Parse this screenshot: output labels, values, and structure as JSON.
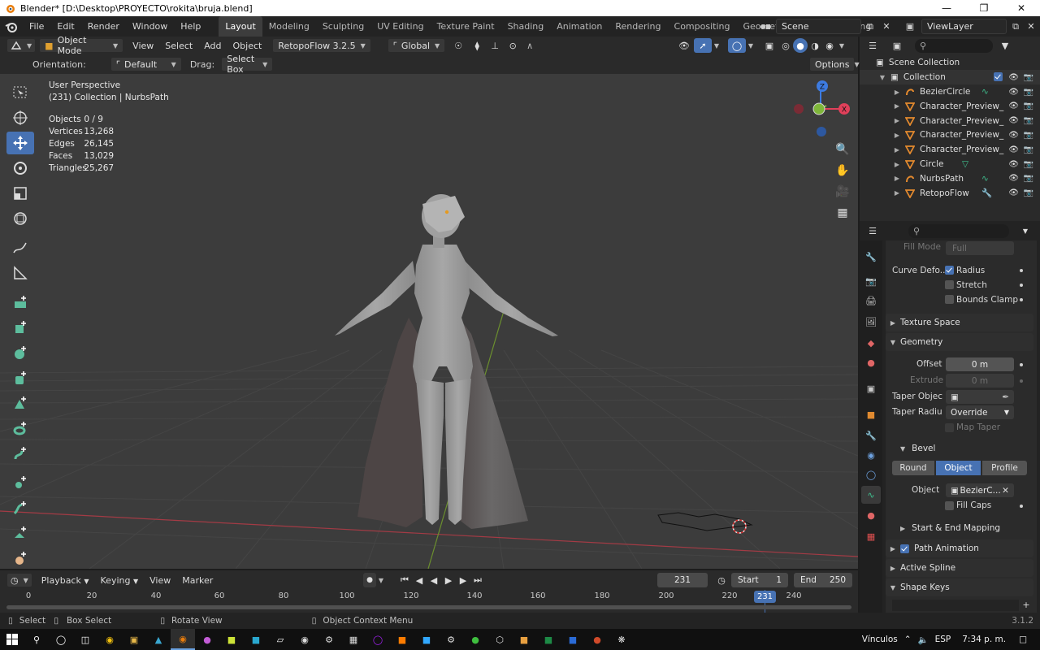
{
  "window": {
    "title": "Blender* [D:\\Desktop\\PROYECTO\\rokita\\bruja.blend]"
  },
  "menu": [
    "File",
    "Edit",
    "Render",
    "Window",
    "Help"
  ],
  "workspaces": [
    "Layout",
    "Modeling",
    "Sculpting",
    "UV Editing",
    "Texture Paint",
    "Shading",
    "Animation",
    "Rendering",
    "Compositing",
    "Geometry Nodes",
    "Scripting"
  ],
  "active_workspace": "Layout",
  "scene": "Scene",
  "view_layer": "ViewLayer",
  "viewport_header": {
    "mode": "Object Mode",
    "menus": [
      "View",
      "Select",
      "Add",
      "Object"
    ],
    "addon": "RetopoFlow 3.2.5",
    "transform_orientation": "Global"
  },
  "tool_settings": {
    "orientation_label": "Orientation:",
    "orientation_value": "Default",
    "drag_label": "Drag:",
    "drag_value": "Select Box",
    "options_label": "Options"
  },
  "overlay": {
    "view_name": "User Perspective",
    "context": "(231) Collection | NurbsPath",
    "stats": [
      {
        "label": "Objects",
        "value": "0 / 9"
      },
      {
        "label": "Vertices",
        "value": "13,268"
      },
      {
        "label": "Edges",
        "value": "26,145"
      },
      {
        "label": "Faces",
        "value": "13,029"
      },
      {
        "label": "Triangles",
        "value": "25,267"
      }
    ]
  },
  "gizmo": {
    "z": "Z",
    "x": "X"
  },
  "outliner": {
    "scene_collection": "Scene Collection",
    "collection": "Collection",
    "items": [
      {
        "name": "BezierCircle",
        "type": "curve"
      },
      {
        "name": "Character_Preview_",
        "type": "mesh"
      },
      {
        "name": "Character_Preview_",
        "type": "mesh"
      },
      {
        "name": "Character_Preview_",
        "type": "mesh"
      },
      {
        "name": "Character_Preview_",
        "type": "mesh"
      },
      {
        "name": "Circle",
        "type": "mesh"
      },
      {
        "name": "NurbsPath",
        "type": "curve"
      },
      {
        "name": "RetopoFlow",
        "type": "mesh"
      }
    ]
  },
  "properties": {
    "fill_mode_label": "Fill Mode",
    "fill_mode_value": "Full",
    "curve_deform_label": "Curve Defo...",
    "radius": {
      "label": "Radius",
      "checked": true
    },
    "stretch": {
      "label": "Stretch",
      "checked": false
    },
    "bounds_clamp": {
      "label": "Bounds Clamp",
      "checked": false
    },
    "texture_space": "Texture Space",
    "geometry": "Geometry",
    "offset_label": "Offset",
    "offset_value": "0 m",
    "extrude_label": "Extrude",
    "extrude_value": "0 m",
    "taper_object_label": "Taper Objec",
    "taper_radius_label": "Taper Radiu",
    "taper_radius_value": "Override",
    "map_taper": "Map Taper",
    "bevel": "Bevel",
    "bevel_modes": [
      "Round",
      "Object",
      "Profile"
    ],
    "bevel_active": "Object",
    "bevel_object_label": "Object",
    "bevel_object_value": "BezierC...",
    "fill_caps": "Fill Caps",
    "start_end_mapping": "Start & End Mapping",
    "path_animation": "Path Animation",
    "active_spline": "Active Spline",
    "shape_keys": "Shape Keys"
  },
  "timeline": {
    "menus": [
      "Playback",
      "Keying",
      "View",
      "Marker"
    ],
    "current_frame": "231",
    "start_label": "Start",
    "start_value": "1",
    "end_label": "End",
    "end_value": "250",
    "ticks": [
      "0",
      "20",
      "40",
      "60",
      "80",
      "100",
      "120",
      "140",
      "160",
      "180",
      "200",
      "220",
      "240"
    ],
    "playhead": "231"
  },
  "status": {
    "select": "Select",
    "box_select": "Box Select",
    "rotate_view": "Rotate View",
    "context_menu": "Object Context Menu",
    "version": "3.1.2"
  },
  "taskbar": {
    "tray_label": "Vínculos",
    "lang": "ESP",
    "time": "7:34 p. m."
  },
  "colors": {
    "accent": "#4772b3",
    "x_axis": "#e0405a",
    "y_axis": "#7fb63a",
    "z_axis": "#3d7be0"
  }
}
